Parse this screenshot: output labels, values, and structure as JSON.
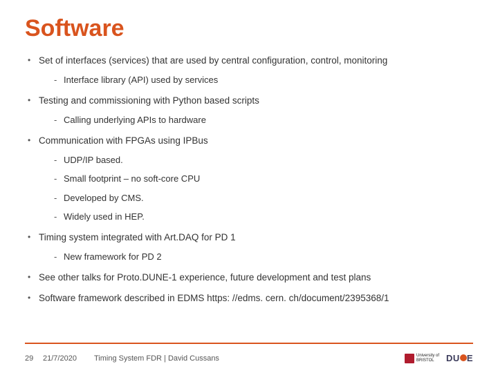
{
  "title": "Software",
  "bullets": {
    "b0": "Set of interfaces (services) that are used by central configuration, control, monitoring",
    "b0s0": "Interface library (API) used by services",
    "b1": "Testing and commissioning with Python based scripts",
    "b1s0": "Calling underlying APIs to hardware",
    "b2": "Communication with FPGAs using IPBus",
    "b2s0": "UDP/IP based.",
    "b2s1": "Small footprint – no soft-core CPU",
    "b2s2": "Developed by CMS.",
    "b2s3": "Widely used in HEP.",
    "b3": "Timing system integrated with Art.DAQ for PD 1",
    "b3s0": "New framework for PD 2",
    "b4": "See other talks for Proto.DUNE-1 experience, future development and test plans",
    "b5": "Software framework described in EDMS https: //edms. cern. ch/document/2395368/1"
  },
  "footer": {
    "page": "29",
    "date": "21/7/2020",
    "title": "Timing System FDR | David Cussans"
  },
  "logos": {
    "bristol_line1": "University of",
    "bristol_line2": "BRISTOL",
    "dune_prefix": "DU",
    "dune_suffix": "E"
  }
}
